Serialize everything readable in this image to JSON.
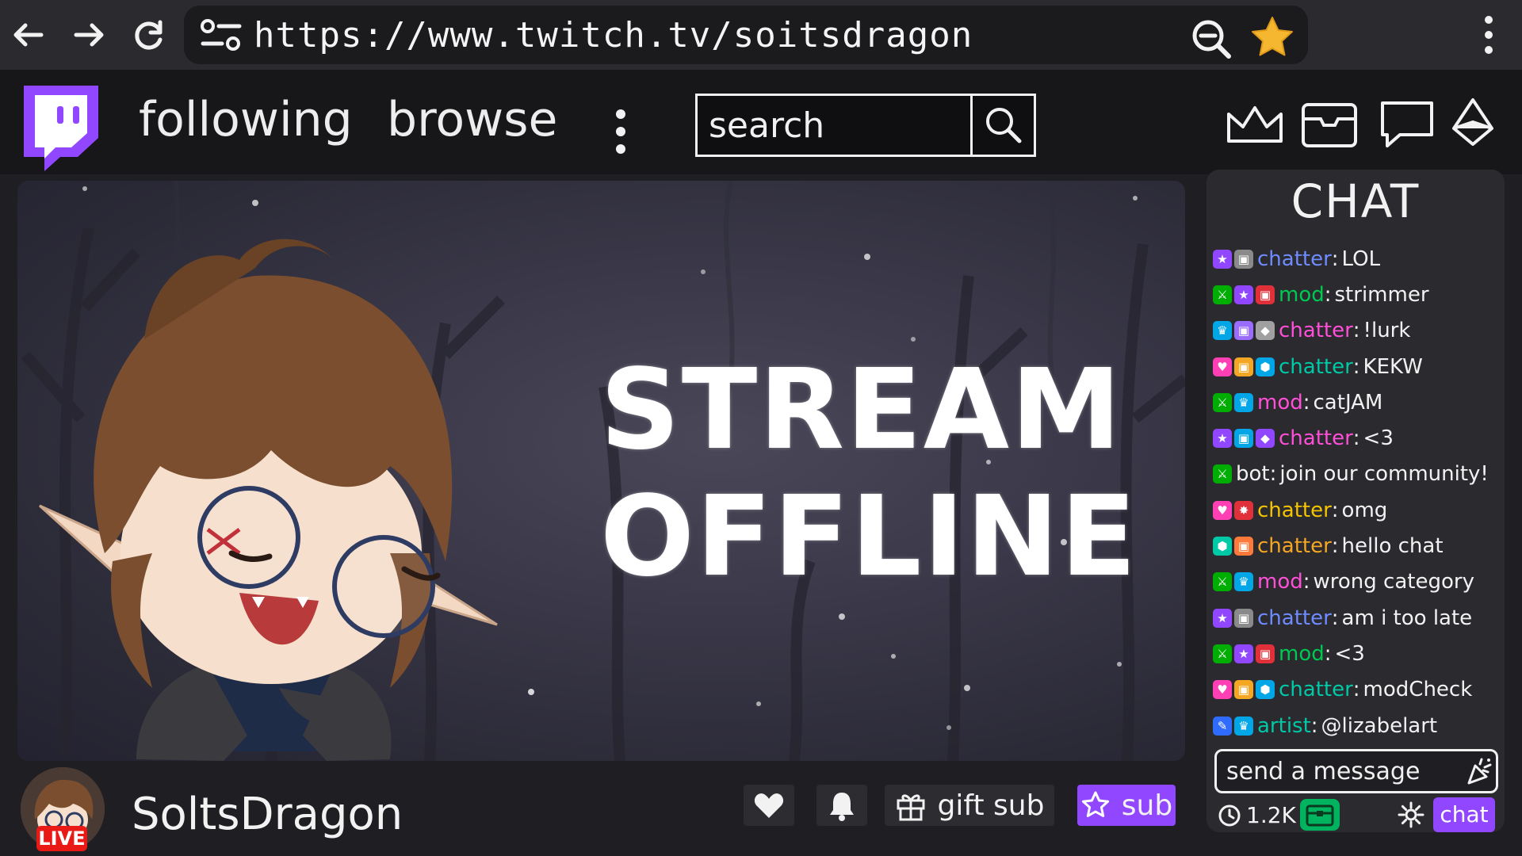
{
  "browser": {
    "url": "https://www.twitch.tv/soitsdragon",
    "back_icon": "arrow-left-icon",
    "forward_icon": "arrow-right-icon",
    "reload_icon": "reload-icon",
    "site_settings_icon": "tune-icon",
    "zoom_icon": "zoom-out-icon",
    "bookmark_icon": "star-icon",
    "menu_icon": "kebab-menu-icon",
    "star_color": "#f5b72f"
  },
  "nav": {
    "logo_icon": "twitch-logo-icon",
    "logo_color": "#9147ff",
    "following": "following",
    "browse": "browse",
    "more_icon": "kebab-menu-icon",
    "search_placeholder": "search",
    "icons": [
      "crown-icon",
      "inbox-icon",
      "whispers-icon",
      "bits-icon"
    ]
  },
  "player": {
    "line1": "STREAM",
    "line2": "OFFLINE"
  },
  "channel": {
    "name": "SoltsDragon",
    "live": "LIVE",
    "live_color": "#e91916",
    "gift_label": "gift sub",
    "sub_label": "sub",
    "sub_color": "#9147ff"
  },
  "chat": {
    "title": "CHAT",
    "placeholder": "send a message",
    "viewers": "1.2K",
    "chat_button": "chat",
    "messages": [
      {
        "badges": [
          {
            "icon": "prime-icon",
            "color": "#9147ff"
          },
          {
            "icon": "gift-icon",
            "color": "#8a8a8a"
          }
        ],
        "user": "chatter",
        "color": "#6f8cff",
        "text": "LOL"
      },
      {
        "badges": [
          {
            "icon": "mod-icon",
            "color": "#00ad03"
          },
          {
            "icon": "prime-icon",
            "color": "#9147ff"
          },
          {
            "icon": "gift-icon",
            "color": "#e0303a"
          }
        ],
        "user": "mod",
        "color": "#00c853",
        "text": "strimmer"
      },
      {
        "badges": [
          {
            "icon": "crown-icon",
            "color": "#00a6e6"
          },
          {
            "icon": "gift-icon",
            "color": "#9a6cff"
          },
          {
            "icon": "vip-icon",
            "color": "#a0a0a0"
          }
        ],
        "user": "chatter",
        "color": "#ff4fd8",
        "text": "!lurk"
      },
      {
        "badges": [
          {
            "icon": "heart-icon",
            "color": "#ff3fb4"
          },
          {
            "icon": "gift-icon",
            "color": "#f5a623"
          },
          {
            "icon": "hexagon-icon",
            "color": "#00a6e6"
          }
        ],
        "user": "chatter",
        "color": "#00c9a7",
        "text": "KEKW"
      },
      {
        "badges": [
          {
            "icon": "mod-icon",
            "color": "#00ad03"
          },
          {
            "icon": "crown-icon",
            "color": "#00a6e6"
          }
        ],
        "user": "mod",
        "color": "#ff4fd8",
        "text": "catJAM"
      },
      {
        "badges": [
          {
            "icon": "prime-icon",
            "color": "#9147ff"
          },
          {
            "icon": "gift-icon",
            "color": "#00a6e6"
          },
          {
            "icon": "drop-icon",
            "color": "#9147ff"
          }
        ],
        "user": "chatter",
        "color": "#ff4fd8",
        "text": "<3"
      },
      {
        "badges": [
          {
            "icon": "mod-icon",
            "color": "#00ad03"
          }
        ],
        "user": "bot",
        "color": "#f2f2f2",
        "text": "join our community!"
      },
      {
        "badges": [
          {
            "icon": "heart-icon",
            "color": "#ff3fb4"
          },
          {
            "icon": "spark-icon",
            "color": "#e0303a"
          }
        ],
        "user": "chatter",
        "color": "#f5c400",
        "text": "omg"
      },
      {
        "badges": [
          {
            "icon": "hexagon-icon",
            "color": "#00c9a7"
          },
          {
            "icon": "gift-icon",
            "color": "#ff7a3a"
          }
        ],
        "user": "chatter",
        "color": "#f5a623",
        "text": "hello chat"
      },
      {
        "badges": [
          {
            "icon": "mod-icon",
            "color": "#00ad03"
          },
          {
            "icon": "crown-icon",
            "color": "#00a6e6"
          }
        ],
        "user": "mod",
        "color": "#ff4fd8",
        "text": "wrong category"
      },
      {
        "badges": [
          {
            "icon": "prime-icon",
            "color": "#9147ff"
          },
          {
            "icon": "gift-icon",
            "color": "#8a8a8a"
          }
        ],
        "user": "chatter",
        "color": "#6f8cff",
        "text": "am i too late"
      },
      {
        "badges": [
          {
            "icon": "mod-icon",
            "color": "#00ad03"
          },
          {
            "icon": "prime-icon",
            "color": "#9147ff"
          },
          {
            "icon": "gift-icon",
            "color": "#e0303a"
          }
        ],
        "user": "mod",
        "color": "#00c853",
        "text": "<3"
      },
      {
        "badges": [
          {
            "icon": "heart-icon",
            "color": "#ff3fb4"
          },
          {
            "icon": "gift-icon",
            "color": "#f5a623"
          },
          {
            "icon": "hexagon-icon",
            "color": "#00a6e6"
          }
        ],
        "user": "chatter",
        "color": "#00c9a7",
        "text": "modCheck"
      },
      {
        "badges": [
          {
            "icon": "brush-icon",
            "color": "#2f6bff"
          },
          {
            "icon": "crown-icon",
            "color": "#00a6e6"
          }
        ],
        "user": "artist",
        "color": "#00c9a7",
        "text": "@lizabelart"
      }
    ]
  }
}
